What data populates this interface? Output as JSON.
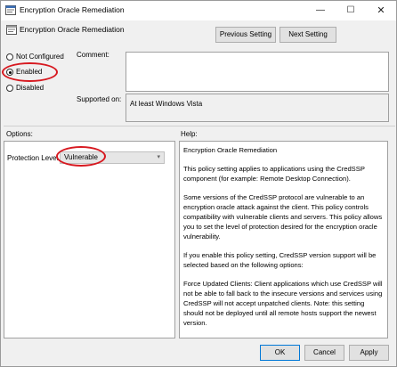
{
  "window": {
    "title": "Encryption Oracle Remediation",
    "controls": {
      "minimize": "—",
      "maximize": "☐",
      "close": "✕"
    }
  },
  "header": {
    "policy_name": "Encryption Oracle Remediation",
    "previous_label": "Previous Setting",
    "next_label": "Next Setting"
  },
  "state": {
    "options": [
      "Not Configured",
      "Enabled",
      "Disabled"
    ],
    "selected": "Enabled"
  },
  "comment": {
    "label": "Comment:",
    "value": ""
  },
  "supported": {
    "label": "Supported on:",
    "value": "At least Windows Vista"
  },
  "options": {
    "label": "Options:",
    "protection_level_label": "Protection Level",
    "protection_level_value": "Vulnerable"
  },
  "help": {
    "label": "Help:",
    "paragraphs": [
      "Encryption Oracle Remediation",
      "This policy setting applies to applications using the CredSSP component (for example: Remote Desktop Connection).",
      "Some versions of the CredSSP protocol are vulnerable to an encryption oracle attack against the client.  This policy controls compatibility with vulnerable clients and servers.  This policy allows you to set the level of protection desired for the encryption oracle vulnerability.",
      "If you enable this policy setting, CredSSP version support will be selected based on the following options:",
      "Force Updated Clients: Client applications which use CredSSP will not be able to fall back to the insecure versions and services using CredSSP will not accept unpatched clients. Note: this setting should not be deployed until all remote hosts support the newest version."
    ]
  },
  "footer": {
    "ok_label": "OK",
    "cancel_label": "Cancel",
    "apply_label": "Apply"
  },
  "colors": {
    "annotation": "#d71920",
    "accent": "#0078d7"
  }
}
